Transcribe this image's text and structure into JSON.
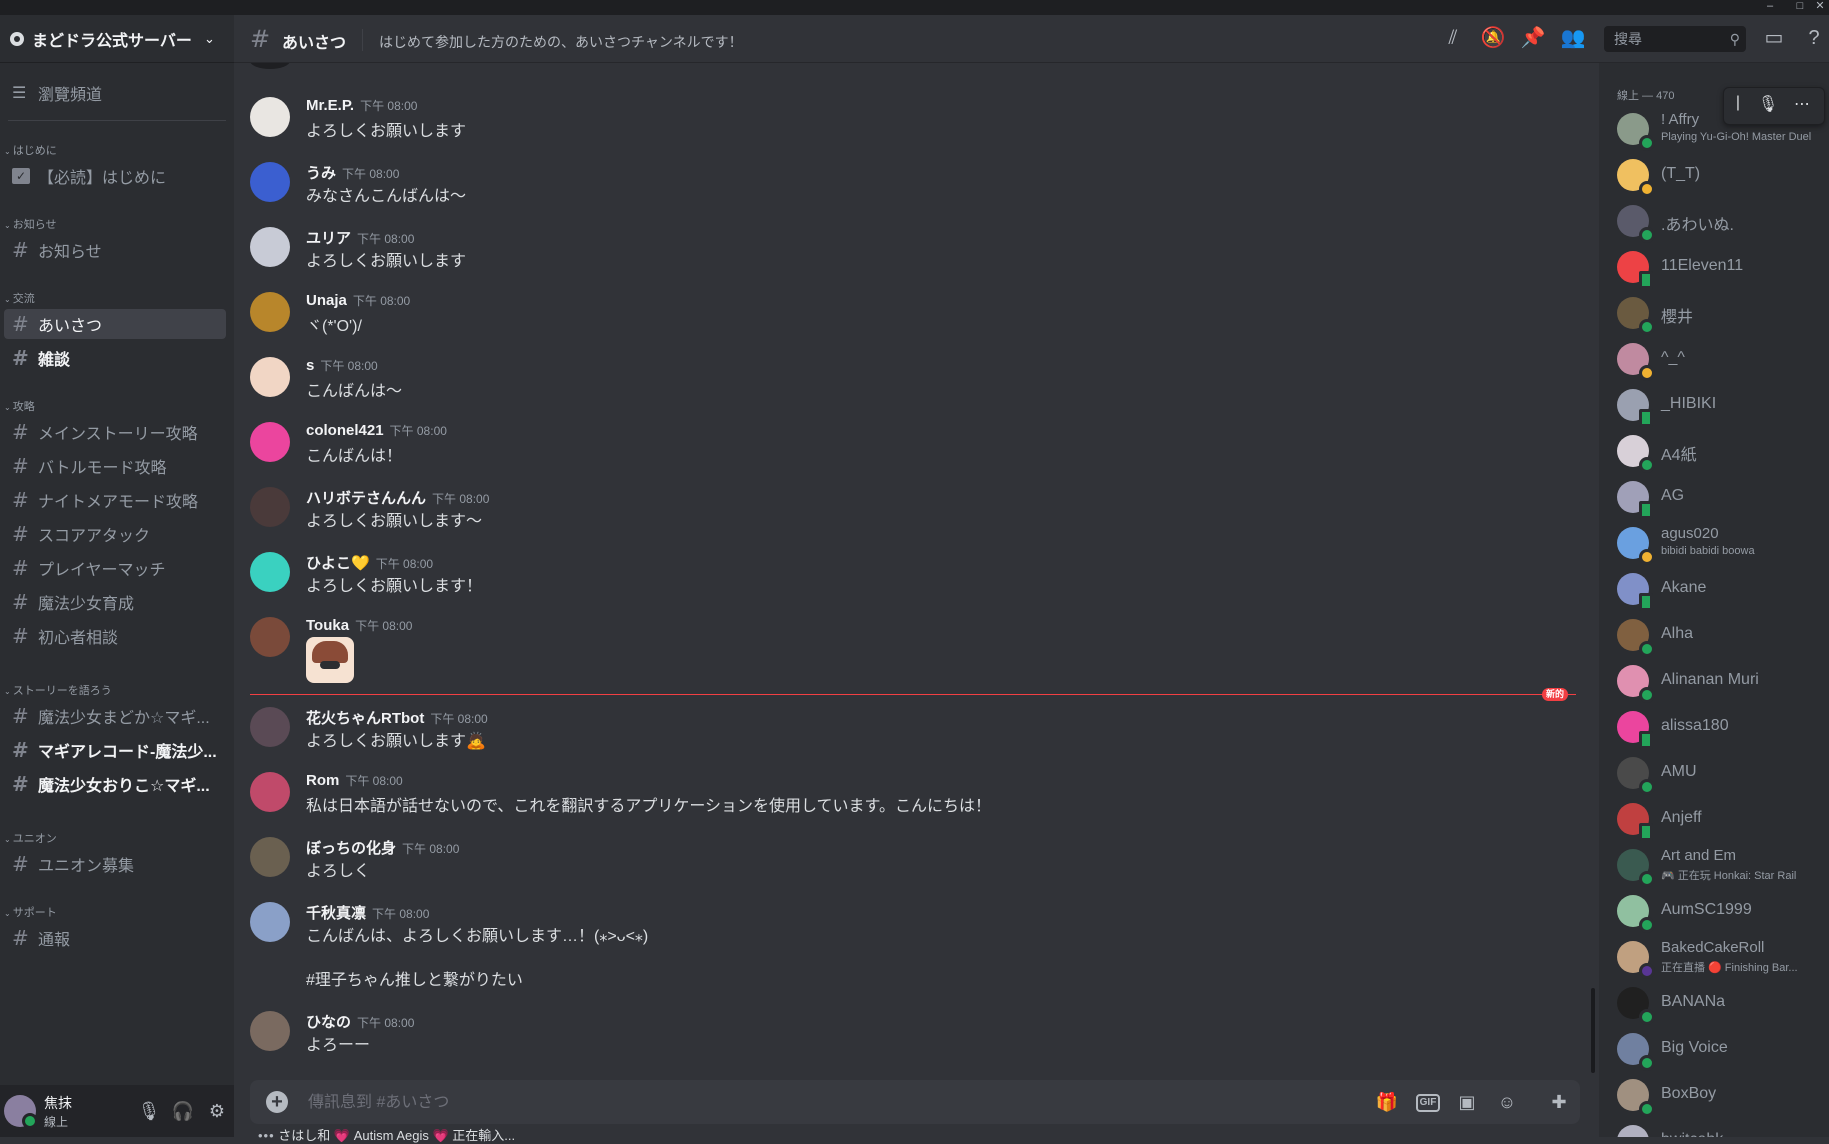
{
  "window": {
    "minimize": "–",
    "maximize": "□",
    "close": "✕"
  },
  "server": {
    "name": "まどドラ公式サーバー"
  },
  "sidebar": {
    "browse_label": "瀏覽頻道",
    "categories": [
      "はじめに",
      "お知らせ",
      "交流",
      "攻略",
      "ストーリーを語ろう",
      "ユニオン",
      "サポート"
    ],
    "channels": [
      {
        "name": "【必読】はじめに",
        "category": "はじめに",
        "kind": "rules"
      },
      {
        "name": "お知らせ",
        "category": "お知らせ",
        "kind": "text"
      },
      {
        "name": "あいさつ",
        "category": "交流",
        "kind": "text",
        "active": true
      },
      {
        "name": "雑談",
        "category": "交流",
        "kind": "text",
        "unread": true
      },
      {
        "name": "メインストーリー攻略",
        "category": "攻略",
        "kind": "text"
      },
      {
        "name": "バトルモード攻略",
        "category": "攻略",
        "kind": "text"
      },
      {
        "name": "ナイトメアモード攻略",
        "category": "攻略",
        "kind": "text"
      },
      {
        "name": "スコアアタック",
        "category": "攻略",
        "kind": "text"
      },
      {
        "name": "プレイヤーマッチ",
        "category": "攻略",
        "kind": "text"
      },
      {
        "name": "魔法少女育成",
        "category": "攻略",
        "kind": "text"
      },
      {
        "name": "初心者相談",
        "category": "攻略",
        "kind": "text"
      },
      {
        "name": "魔法少女まどか☆マギ...",
        "category": "ストーリーを語ろう",
        "kind": "text"
      },
      {
        "name": "マギアレコード-魔法少...",
        "category": "ストーリーを語ろう",
        "kind": "text",
        "unread": true
      },
      {
        "name": "魔法少女おりこ☆マギ...",
        "category": "ストーリーを語ろう",
        "kind": "text",
        "unread": true
      },
      {
        "name": "ユニオン募集",
        "category": "ユニオン",
        "kind": "text"
      },
      {
        "name": "通報",
        "category": "サポート",
        "kind": "text"
      }
    ]
  },
  "user_panel": {
    "name": "焦抹",
    "status": "線上"
  },
  "header": {
    "channel": "あいさつ",
    "topic": "はじめて参加した方のための、あいさつチャンネルです！",
    "search_placeholder": "搜尋"
  },
  "messages": [
    {
      "author": "Mr.E.P.",
      "time": "下午 08:00",
      "text": "よろしくお願いします",
      "avatar_color": "#e9e6e2"
    },
    {
      "author": "うみ",
      "time": "下午 08:00",
      "text": "みなさんこんばんは～",
      "avatar_color": "#3b5fd0"
    },
    {
      "author": "ユリア",
      "time": "下午 08:00",
      "text": "よろしくお願いします",
      "avatar_color": "#c8cbd6"
    },
    {
      "author": "Unaja",
      "time": "下午 08:00",
      "text": "ヾ(*'O')/",
      "avatar_color": "#b8862b"
    },
    {
      "author": "s",
      "time": "下午 08:00",
      "text": "こんばんは～",
      "avatar_color": "#f1d6c5"
    },
    {
      "author": "colonel421",
      "time": "下午 08:00",
      "text": "こんばんは！",
      "avatar_color": "#eb459e"
    },
    {
      "author": "ハリボテさんんん",
      "time": "下午 08:00",
      "text": "よろしくお願いします～",
      "avatar_color": "#4a3a3a"
    },
    {
      "author": "ひよこ💛",
      "time": "下午 08:00",
      "text": "よろしくお願いします！",
      "avatar_color": "#3ad1c0"
    },
    {
      "author": "Touka",
      "time": "下午 08:00",
      "text": "",
      "avatar_color": "#7a4a3a",
      "sticker": true
    },
    {
      "author": "花火ちゃんRTbot",
      "time": "下午 08:00",
      "text": "よろしくお願いします🙇",
      "avatar_color": "#5a4a55"
    },
    {
      "author": "Rom",
      "time": "下午 08:00",
      "text": "私は日本語が話せないので、これを翻訳するアプリケーションを使用しています。こんにちは！",
      "avatar_color": "#c04a6a"
    },
    {
      "author": "ぼっちの化身",
      "time": "下午 08:00",
      "text": "よろしく",
      "avatar_color": "#6a6050"
    },
    {
      "author": "千秋真凛",
      "time": "下午 08:00",
      "text": "こんばんは、よろしくお願いします…！(⁎˃ᴗ˂⁎)",
      "text2": "#理子ちゃん推しと繋がりたい",
      "avatar_color": "#8aa0c8"
    },
    {
      "author": "ひなの",
      "time": "下午 08:00",
      "text": "よろーー",
      "avatar_color": "#7a6a60"
    }
  ],
  "new_divider": "新的",
  "composer": {
    "placeholder": "傳訊息到 #あいさつ"
  },
  "typing": {
    "text": "さはし和 💗 Autism Aegis 💗 正在輸入..."
  },
  "members": {
    "group_label": "線上 — 470",
    "list": [
      {
        "name": "! Affry",
        "activity": "Playing Yu-Gi-Oh! Master Duel",
        "status": "online",
        "color": "#8a9a8a"
      },
      {
        "name": "(T_T)",
        "activity": "",
        "status": "idle",
        "color": "#f0c060"
      },
      {
        "name": ".あわいぬ.",
        "activity": "",
        "status": "online",
        "color": "#5a5a6a"
      },
      {
        "name": "11Eleven11",
        "activity": "",
        "status": "mobile",
        "color": "#ed4245"
      },
      {
        "name": "櫻井",
        "activity": "",
        "status": "online",
        "color": "#6a5a40"
      },
      {
        "name": "^_^",
        "activity": "",
        "status": "idle",
        "color": "#c08aa0"
      },
      {
        "name": "_HIBIKI",
        "activity": "",
        "status": "mobile",
        "color": "#9aa0b0"
      },
      {
        "name": "A4紙",
        "activity": "",
        "status": "online",
        "color": "#d8d0d8"
      },
      {
        "name": "AG",
        "activity": "",
        "status": "mobile",
        "color": "#a0a0b8"
      },
      {
        "name": "agus020",
        "activity": "bibidi babidi boowa",
        "status": "idle",
        "color": "#6aa0e0"
      },
      {
        "name": "Akane",
        "activity": "",
        "status": "mobile",
        "color": "#8090c8"
      },
      {
        "name": "Alha",
        "activity": "",
        "status": "online",
        "color": "#806040"
      },
      {
        "name": "Alinanan Muri",
        "activity": "",
        "status": "online",
        "color": "#e090b0"
      },
      {
        "name": "alissa180",
        "activity": "",
        "status": "mobile",
        "color": "#eb459e"
      },
      {
        "name": "AMU",
        "activity": "",
        "status": "online",
        "color": "#4a4a4a"
      },
      {
        "name": "Anjeff",
        "activity": "",
        "status": "mobile",
        "color": "#c04040"
      },
      {
        "name": "Art and Em",
        "activity": "🎮 正在玩 Honkai: Star Rail",
        "status": "online",
        "color": "#3a5a50"
      },
      {
        "name": "AumSC1999",
        "activity": "",
        "status": "online",
        "color": "#90c0a0"
      },
      {
        "name": "BakedCakeRoll",
        "activity": "正在直播 🔴 Finishing Bar...",
        "status": "streaming",
        "color": "#c0a080"
      },
      {
        "name": "BANANa",
        "activity": "",
        "status": "online",
        "color": "#202020"
      },
      {
        "name": "Big Voice",
        "activity": "",
        "status": "online",
        "color": "#7080a0"
      },
      {
        "name": "BoxBoy",
        "activity": "",
        "status": "online",
        "color": "#a09080"
      },
      {
        "name": "bwitcahk",
        "activity": "",
        "status": "online",
        "color": "#b0b0c0"
      }
    ]
  },
  "colors": {
    "accent": "#5865f2",
    "new_divider": "#f23f43",
    "online": "#23a55a",
    "idle": "#f0b232"
  }
}
